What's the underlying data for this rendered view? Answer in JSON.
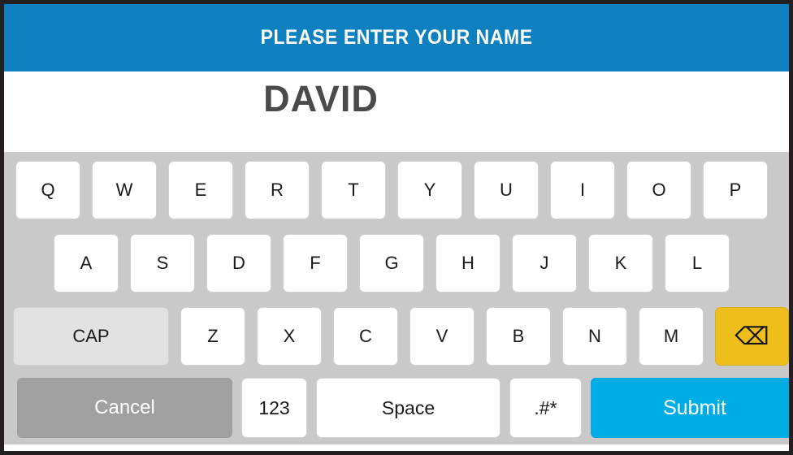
{
  "header": {
    "title": "PLEASE ENTER YOUR NAME",
    "background_color": "#0E80BF",
    "text_color": "#FFFFFF"
  },
  "entry": {
    "value": "DAVID",
    "placeholder": "",
    "text_color": "#4A4A4A"
  },
  "keyboard": {
    "background_color": "#C9C9C9",
    "rows": [
      {
        "name": "row-1",
        "keys": [
          {
            "label": "Q",
            "name": "key-q"
          },
          {
            "label": "W",
            "name": "key-w"
          },
          {
            "label": "E",
            "name": "key-e"
          },
          {
            "label": "R",
            "name": "key-r"
          },
          {
            "label": "T",
            "name": "key-t"
          },
          {
            "label": "Y",
            "name": "key-y"
          },
          {
            "label": "U",
            "name": "key-u"
          },
          {
            "label": "I",
            "name": "key-i"
          },
          {
            "label": "O",
            "name": "key-o"
          },
          {
            "label": "P",
            "name": "key-p"
          }
        ]
      },
      {
        "name": "row-2",
        "keys": [
          {
            "label": "A",
            "name": "key-a"
          },
          {
            "label": "S",
            "name": "key-s"
          },
          {
            "label": "D",
            "name": "key-d"
          },
          {
            "label": "F",
            "name": "key-f"
          },
          {
            "label": "G",
            "name": "key-g"
          },
          {
            "label": "H",
            "name": "key-h"
          },
          {
            "label": "J",
            "name": "key-j"
          },
          {
            "label": "K",
            "name": "key-k"
          },
          {
            "label": "L",
            "name": "key-l"
          }
        ]
      },
      {
        "name": "row-3",
        "keys": [
          {
            "label": "CAP",
            "name": "key-cap"
          },
          {
            "label": "Z",
            "name": "key-z"
          },
          {
            "label": "X",
            "name": "key-x"
          },
          {
            "label": "C",
            "name": "key-c"
          },
          {
            "label": "V",
            "name": "key-v"
          },
          {
            "label": "B",
            "name": "key-b"
          },
          {
            "label": "N",
            "name": "key-n"
          },
          {
            "label": "M",
            "name": "key-m"
          },
          {
            "label": "⌫",
            "name": "backspace-icon"
          }
        ]
      },
      {
        "name": "row-4",
        "keys": [
          {
            "label": "Cancel",
            "name": "cancel-button"
          },
          {
            "label": "123",
            "name": "numbers-button"
          },
          {
            "label": "Space",
            "name": "space-button"
          },
          {
            "label": ".#*",
            "name": "symbols-button"
          },
          {
            "label": "Submit",
            "name": "submit-button"
          }
        ]
      }
    ],
    "colors": {
      "key": "#FFFFFF",
      "cap_key": "#E2E2E2",
      "backspace_key": "#EEBE1D",
      "cancel_button": "#A0A0A0",
      "submit_button": "#00ACE4"
    }
  }
}
